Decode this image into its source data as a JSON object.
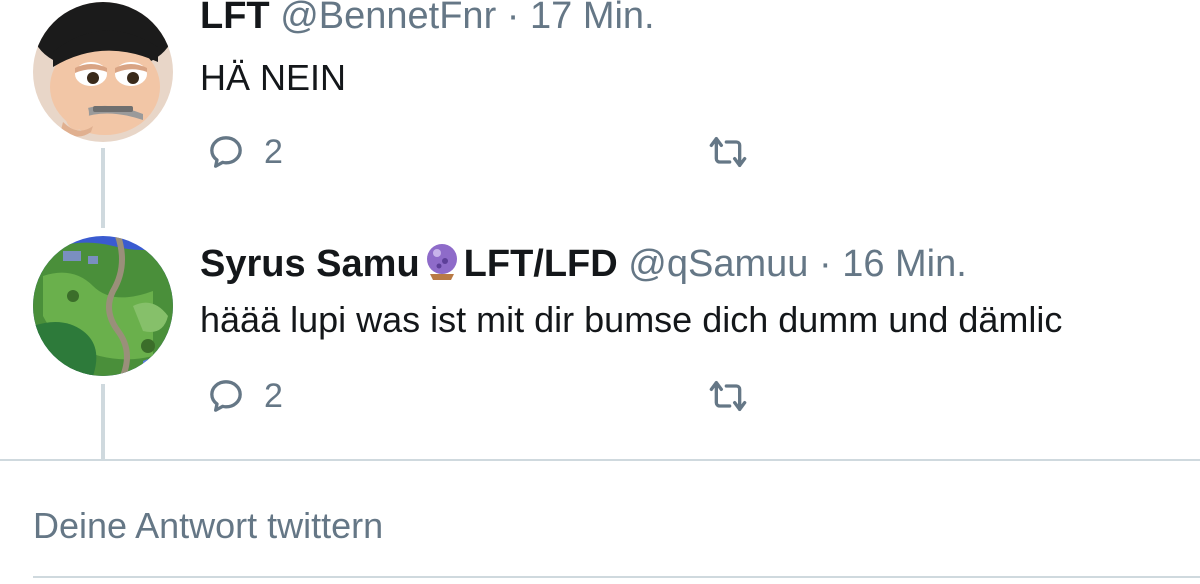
{
  "tweets": [
    {
      "name": "LFT",
      "handle": "@BennetFnr",
      "separator": "·",
      "time": "17 Min.",
      "text": "HÄ NEIN",
      "reply_count": "2",
      "avatar_icon": "cartoon-face-avatar"
    },
    {
      "name_part1": "Syrus Samu",
      "name_emoji": "crystal-ball-emoji",
      "name_part2": "LFT/LFD",
      "handle": "@qSamuu",
      "separator": "·",
      "time": "16 Min.",
      "text": "häää lupi was ist mit dir bumse dich dumm und dämlic",
      "reply_count": "2",
      "avatar_icon": "game-map-avatar"
    }
  ],
  "reply_input": {
    "placeholder": "Deine Antwort twittern"
  },
  "colors": {
    "text": "#14171a",
    "secondary": "#657786",
    "line": "#cfd9de"
  }
}
